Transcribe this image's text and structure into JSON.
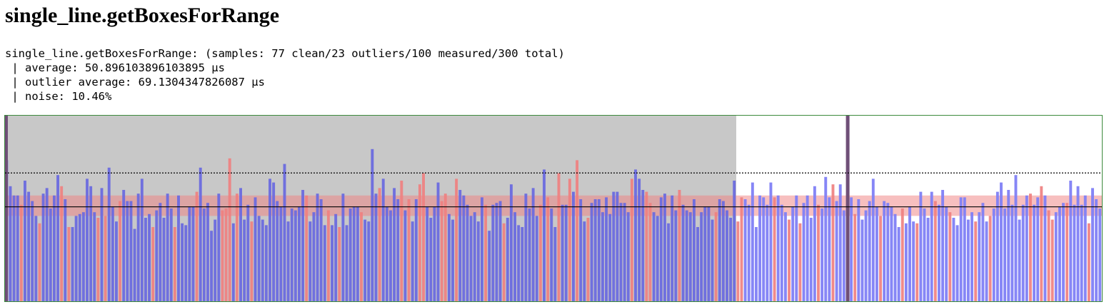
{
  "title": "single_line.getBoxesForRange",
  "stats": {
    "line1": "single_line.getBoxesForRange: (samples: 77 clean/23 outliers/100 measured/300 total)",
    "line2": " | average: 50.896103896103895 µs",
    "line3": " | outlier average: 69.1304347826087 µs",
    "line4": " | noise: 10.46%"
  },
  "colors": {
    "clean": "#6b6bdf",
    "clean_measured": "#8080f5",
    "outlier": "#ef8080",
    "warmup_background": "#c8c8c8",
    "marker": "#6f4f77",
    "average_line": "#000000",
    "noise_band": "#f08080",
    "border": "#3c8a3c"
  },
  "chart_data": {
    "type": "bar",
    "total_samples": 300,
    "warmup_samples": 200,
    "measured_samples": 100,
    "ylim": [
      0,
      100
    ],
    "average": 50.896103896103895,
    "outlier_average": 69.1304347826087,
    "noise_band": [
      46,
      57
    ],
    "values": [
      76,
      62,
      57,
      57,
      52,
      65,
      59,
      54,
      46,
      42,
      58,
      61,
      50,
      57,
      68,
      62,
      55,
      40,
      40,
      46,
      47,
      48,
      66,
      62,
      48,
      45,
      61,
      46,
      72,
      51,
      43,
      54,
      60,
      54,
      54,
      39,
      58,
      66,
      45,
      47,
      40,
      49,
      53,
      45,
      58,
      50,
      40,
      57,
      42,
      41,
      51,
      51,
      59,
      72,
      50,
      53,
      38,
      44,
      58,
      49,
      50,
      77,
      42,
      58,
      61,
      44,
      52,
      43,
      56,
      46,
      44,
      41,
      66,
      64,
      54,
      51,
      74,
      43,
      50,
      49,
      51,
      60,
      57,
      43,
      48,
      58,
      55,
      41,
      49,
      41,
      47,
      40,
      58,
      41,
      50,
      51,
      51,
      48,
      44,
      43,
      82,
      58,
      61,
      66,
      51,
      49,
      61,
      55,
      65,
      49,
      55,
      43,
      55,
      63,
      69,
      51,
      45,
      51,
      64,
      54,
      58,
      47,
      44,
      66,
      60,
      57,
      52,
      46,
      48,
      43,
      56,
      52,
      38,
      52,
      53,
      54,
      42,
      45,
      63,
      48,
      41,
      40,
      58,
      50,
      61,
      46,
      52,
      71,
      56,
      50,
      40,
      69,
      52,
      52,
      66,
      59,
      76,
      55,
      43,
      45,
      53,
      55,
      55,
      48,
      56,
      47,
      59,
      59,
      53,
      53,
      48,
      66,
      71,
      66,
      60,
      59,
      53,
      48,
      46,
      56,
      58,
      42,
      57,
      49,
      60,
      52,
      49,
      48,
      55,
      40,
      48,
      51,
      51,
      44,
      48,
      55,
      54,
      49,
      45,
      65,
      43,
      56,
      55,
      52,
      64,
      40,
      57,
      56,
      52,
      64,
      56,
      57,
      52,
      48,
      44,
      51,
      57,
      42,
      53,
      57,
      45,
      62,
      52,
      50,
      67,
      56,
      63,
      54,
      63,
      49,
      58,
      56,
      47,
      55,
      44,
      49,
      54,
      66,
      51,
      46,
      54,
      53,
      51,
      47,
      40,
      50,
      42,
      51,
      43,
      42,
      59,
      50,
      45,
      59,
      54,
      52,
      60,
      51,
      48,
      45,
      41,
      56,
      56,
      44,
      48,
      43,
      48,
      53,
      43,
      46,
      50,
      59,
      64,
      50,
      60,
      52,
      68,
      44,
      52,
      57,
      58,
      52,
      56,
      62,
      57,
      49,
      44,
      48,
      51,
      53,
      53,
      65,
      52,
      62,
      52,
      57,
      42,
      61,
      55,
      50
    ],
    "outliers": [
      4,
      9,
      15,
      17,
      25,
      27,
      31,
      40,
      46,
      52,
      59,
      60,
      61,
      63,
      67,
      82,
      88,
      91,
      97,
      102,
      108,
      110,
      113,
      114,
      119,
      120,
      123,
      131,
      136,
      146,
      148,
      151,
      154,
      156,
      159,
      171,
      175,
      176,
      184,
      194,
      200,
      201,
      210,
      214,
      217,
      222,
      226,
      230,
      232,
      239,
      245,
      249,
      254,
      258,
      265,
      269,
      280,
      283,
      285,
      286,
      290,
      296
    ]
  }
}
